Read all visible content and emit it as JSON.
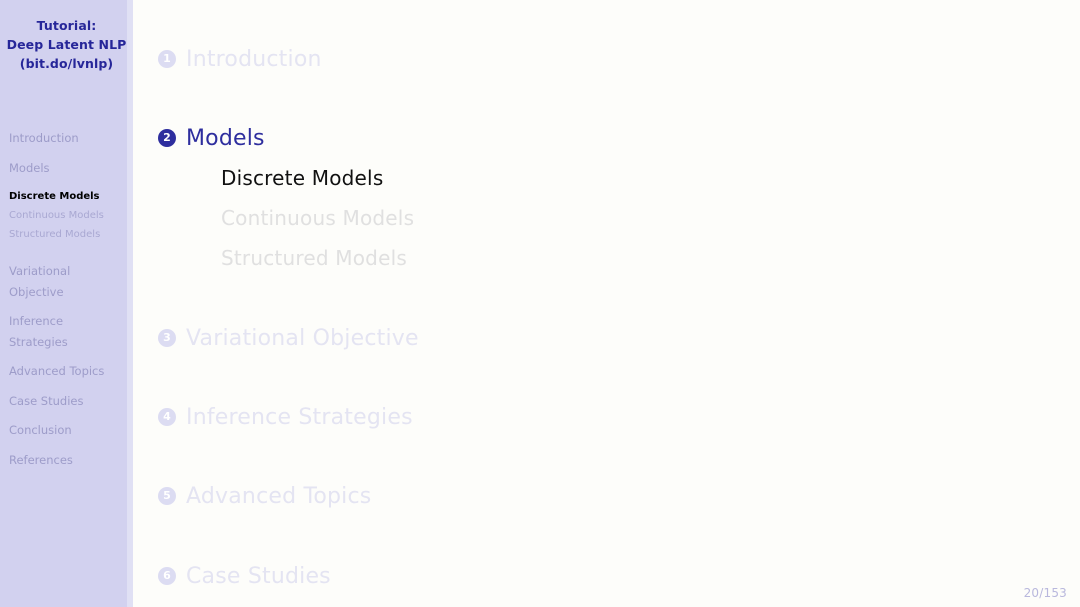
{
  "slide": {
    "background_color": "#fdfdfa",
    "accent_color": "#2e2e9e",
    "sidebar_color": "#d2d1ef"
  },
  "sidebar": {
    "title_lines": [
      "Tutorial:",
      "Deep Latent NLP",
      "(bit.do/lvnlp)"
    ],
    "items": [
      {
        "label": "Introduction",
        "line2": ""
      },
      {
        "label": "Models",
        "line2": ""
      },
      {
        "label": "Variational",
        "line2": "Objective"
      },
      {
        "label": "Inference",
        "line2": "Strategies"
      },
      {
        "label": "Advanced Topics",
        "line2": ""
      },
      {
        "label": "Case Studies",
        "line2": ""
      },
      {
        "label": "Conclusion",
        "line2": ""
      },
      {
        "label": "References",
        "line2": ""
      }
    ],
    "subitems": [
      {
        "label": "Discrete Models"
      },
      {
        "label": "Continuous Models"
      },
      {
        "label": "Structured Models"
      }
    ]
  },
  "toc": {
    "sections": [
      {
        "number": "1",
        "label": "Introduction"
      },
      {
        "number": "2",
        "label": "Models"
      },
      {
        "number": "3",
        "label": "Variational Objective"
      },
      {
        "number": "4",
        "label": "Inference Strategies"
      },
      {
        "number": "5",
        "label": "Advanced Topics"
      },
      {
        "number": "6",
        "label": "Case Studies"
      }
    ],
    "subsections": [
      {
        "label": "Discrete Models"
      },
      {
        "label": "Continuous Models"
      },
      {
        "label": "Structured Models"
      }
    ]
  },
  "footer": {
    "page_indicator": "20/153",
    "current_page": "20",
    "total_pages": "153"
  }
}
